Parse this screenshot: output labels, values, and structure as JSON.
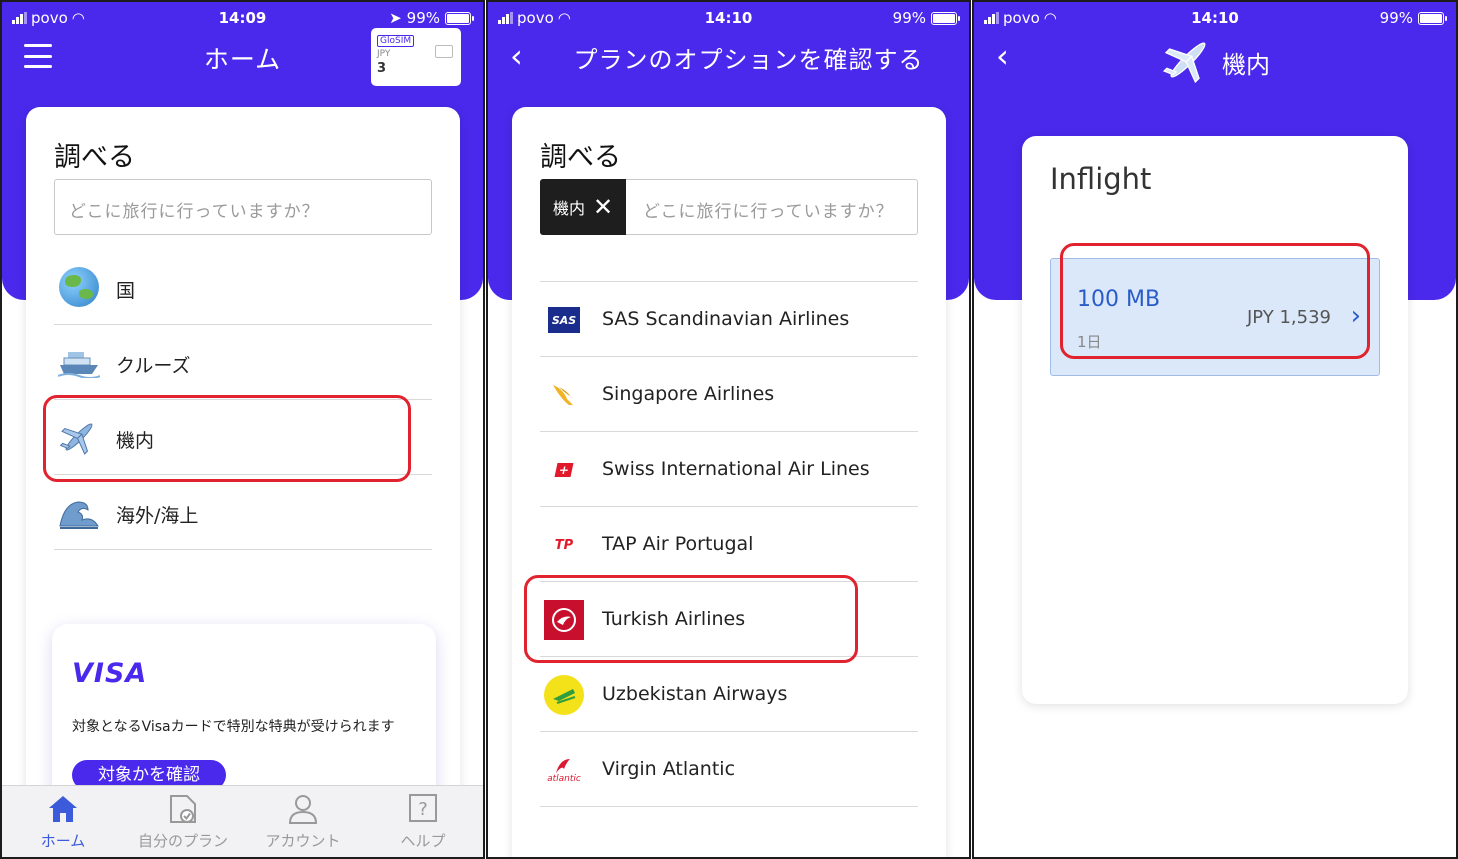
{
  "status_bar": [
    {
      "carrier": "povo",
      "time": "14:09",
      "battery": "99%"
    },
    {
      "carrier": "povo",
      "time": "14:10",
      "battery": "99%"
    },
    {
      "carrier": "povo",
      "time": "14:10",
      "battery": "99%"
    }
  ],
  "screen1": {
    "title": "ホーム",
    "sim_card": {
      "brand": "GloSIM",
      "currency": "JPY",
      "number": "3"
    },
    "search_heading": "調べる",
    "search_placeholder": "どこに旅行に行っていますか？",
    "categories": [
      {
        "label": "国",
        "icon": "globe-icon"
      },
      {
        "label": "クルーズ",
        "icon": "cruise-ship-icon"
      },
      {
        "label": "機内",
        "icon": "airplane-icon"
      },
      {
        "label": "海外/海上",
        "icon": "wave-icon"
      }
    ],
    "visa": {
      "logo": "VISA",
      "description": "対象となるVisaカードで特別な特典が受けられます",
      "button": "対象かを確認"
    },
    "tabs": [
      {
        "label": "ホーム",
        "icon": "home-icon",
        "active": true
      },
      {
        "label": "自分のプラン",
        "icon": "sim-plan-icon",
        "active": false
      },
      {
        "label": "アカウント",
        "icon": "account-icon",
        "active": false
      },
      {
        "label": "ヘルプ",
        "icon": "help-icon",
        "active": false
      }
    ],
    "highlight_color": "#e0232e",
    "accent_color": "#4a29ec"
  },
  "screen2": {
    "title": "プランのオプションを確認する",
    "search_heading": "調べる",
    "filter_chip": "機内",
    "search_placeholder": "どこに旅行に行っていますか？",
    "airlines": [
      {
        "name": "SAS Scandinavian Airlines",
        "logo_text": "SAS",
        "color": "#1a2c8c"
      },
      {
        "name": "Singapore Airlines",
        "logo_text": "",
        "color": "#f0b323"
      },
      {
        "name": "Swiss International Air Lines",
        "logo_text": "+",
        "color": "#e1192a"
      },
      {
        "name": "TAP Air Portugal",
        "logo_text": "TP",
        "color": "#e1192a"
      },
      {
        "name": "Turkish Airlines",
        "logo_text": "",
        "color": "#c8102e"
      },
      {
        "name": "Uzbekistan Airways",
        "logo_text": "",
        "color": "#2e9e3e"
      },
      {
        "name": "Virgin Atlantic",
        "logo_text": "atlantic",
        "color": "#da1a32"
      }
    ]
  },
  "screen3": {
    "title": "機内",
    "card_title": "Inflight",
    "plan": {
      "data": "100 MB",
      "days": "1日",
      "price": "JPY 1,539"
    }
  }
}
